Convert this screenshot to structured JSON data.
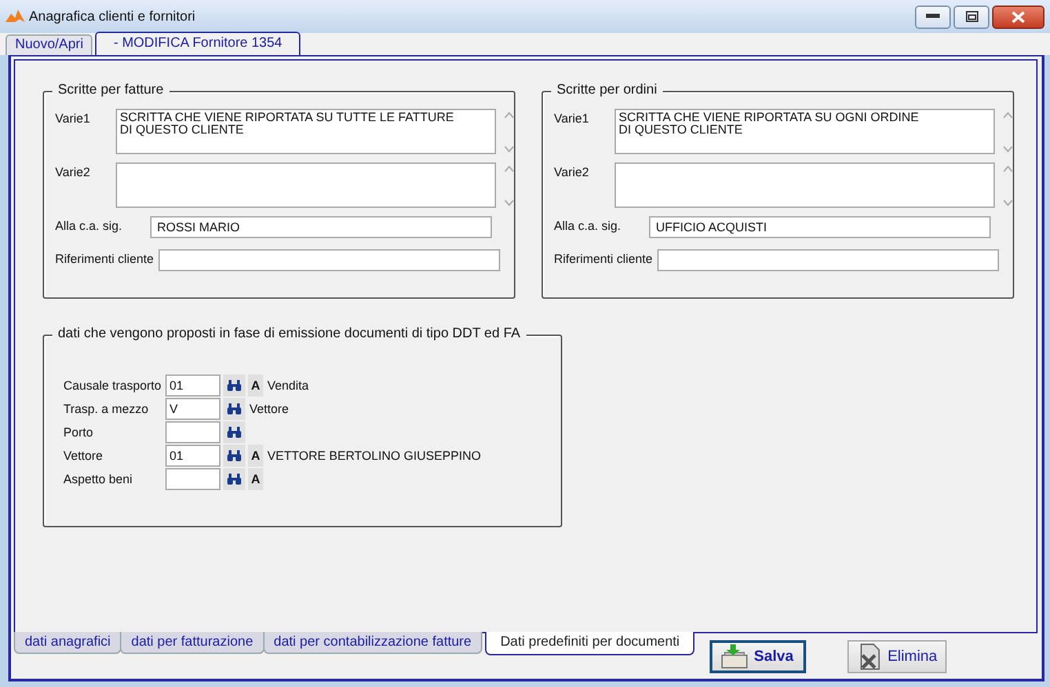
{
  "window": {
    "title": "Anagrafica clienti e fornitori"
  },
  "top_tabs": [
    {
      "label": "Nuovo/Apri",
      "selected": false
    },
    {
      "label": "- MODIFICA Fornitore 1354",
      "selected": true
    }
  ],
  "groups": [
    {
      "title": "Scritte per fatture",
      "fields": [
        {
          "kind": "textarea",
          "label": "Varie1",
          "value": "SCRITTA CHE VIENE RIPORTATA SU TUTTE LE FATTURE\nDI QUESTO CLIENTE"
        },
        {
          "kind": "textarea",
          "label": "Varie2"
        },
        {
          "kind": "input",
          "label": "Alla c.a. sig.",
          "value": "ROSSI MARIO"
        },
        {
          "kind": "input",
          "label": "Riferimenti cliente"
        }
      ]
    },
    {
      "title": "Scritte per ordini",
      "fields": [
        {
          "kind": "textarea",
          "label": "Varie1",
          "value": "SCRITTA CHE VIENE RIPORTATA SU OGNI ORDINE\nDI QUESTO CLIENTE"
        },
        {
          "kind": "textarea",
          "label": "Varie2"
        },
        {
          "kind": "input",
          "label": "Alla c.a. sig.",
          "value": "UFFICIO ACQUISTI"
        },
        {
          "kind": "input",
          "label": "Riferimenti cliente"
        }
      ]
    }
  ],
  "defaults_group": {
    "title": "dati che vengono proposti in fase di emissione documenti di tipo DDT ed FA",
    "rows": [
      {
        "label": "Causale trasporto",
        "value": "01",
        "a_button": "A",
        "description": "Vendita"
      },
      {
        "label": "Trasp. a mezzo",
        "value": "V",
        "description": "Vettore"
      },
      {
        "label": "Porto"
      },
      {
        "label": "Vettore",
        "value": "01",
        "a_button": "A",
        "description": "VETTORE BERTOLINO GIUSEPPINO"
      },
      {
        "label": "Aspetto beni",
        "a_button": "A"
      }
    ]
  },
  "bottom_tabs": [
    {
      "label": "dati anagrafici",
      "selected": false
    },
    {
      "label": "dati per fatturazione",
      "selected": false
    },
    {
      "label": "dati per contabilizzazione fatture",
      "selected": false
    },
    {
      "label": "Dati predefiniti per documenti",
      "selected": true
    }
  ],
  "buttons": [
    {
      "kind": "save",
      "label": "Salva",
      "focused": true
    },
    {
      "kind": "delete",
      "label": "Elimina",
      "focused": false
    }
  ]
}
